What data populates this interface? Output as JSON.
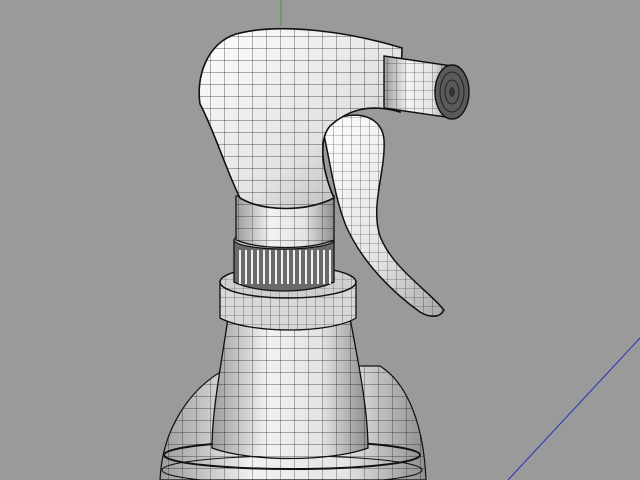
{
  "viewport": {
    "background_color": "#9a9a9a",
    "wire_color": "#111111",
    "surface_color": "#e6e6e6",
    "shadow_color": "#bdbdbd",
    "axis_y_color": "#22aa22",
    "axis_z_color": "#2233bb"
  },
  "model": {
    "icon": "spray-bottle-wireframe"
  }
}
